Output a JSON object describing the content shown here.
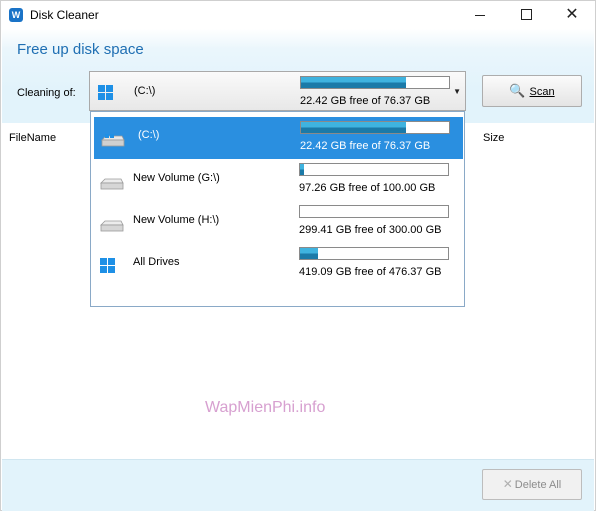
{
  "window": {
    "title": "Disk Cleaner",
    "app_icon_text": "W"
  },
  "header": {
    "heading": "Free up disk space",
    "cleaning_label": "Cleaning of:"
  },
  "combo": {
    "selected_name": "(C:\\)",
    "selected_free": "22.42 GB free of 76.37 GB",
    "selected_used_fraction": 0.71,
    "icon": "windows-drive-icon"
  },
  "scan_button": {
    "label": "Scan",
    "icon": "magnifier-icon"
  },
  "file_list": {
    "columns": [
      "FileName",
      "Size"
    ]
  },
  "dropdown": {
    "items": [
      {
        "name": "(C:\\)",
        "free": "22.42 GB free of 76.37 GB",
        "used_fraction": 0.71,
        "icon": "windows-drive-icon",
        "selected": true
      },
      {
        "name": "New Volume (G:\\)",
        "free": "97.26 GB free of 100.00 GB",
        "used_fraction": 0.03,
        "icon": "drive-icon",
        "selected": false
      },
      {
        "name": "New Volume (H:\\)",
        "free": "299.41 GB free of 300.00 GB",
        "used_fraction": 0.0,
        "icon": "drive-icon",
        "selected": false
      },
      {
        "name": "All Drives",
        "free": "419.09 GB free of 476.37 GB",
        "used_fraction": 0.12,
        "icon": "windows-logo-icon",
        "selected": false
      }
    ]
  },
  "watermark": "WapMienPhi.info",
  "footer": {
    "delete_label": "Delete All"
  }
}
